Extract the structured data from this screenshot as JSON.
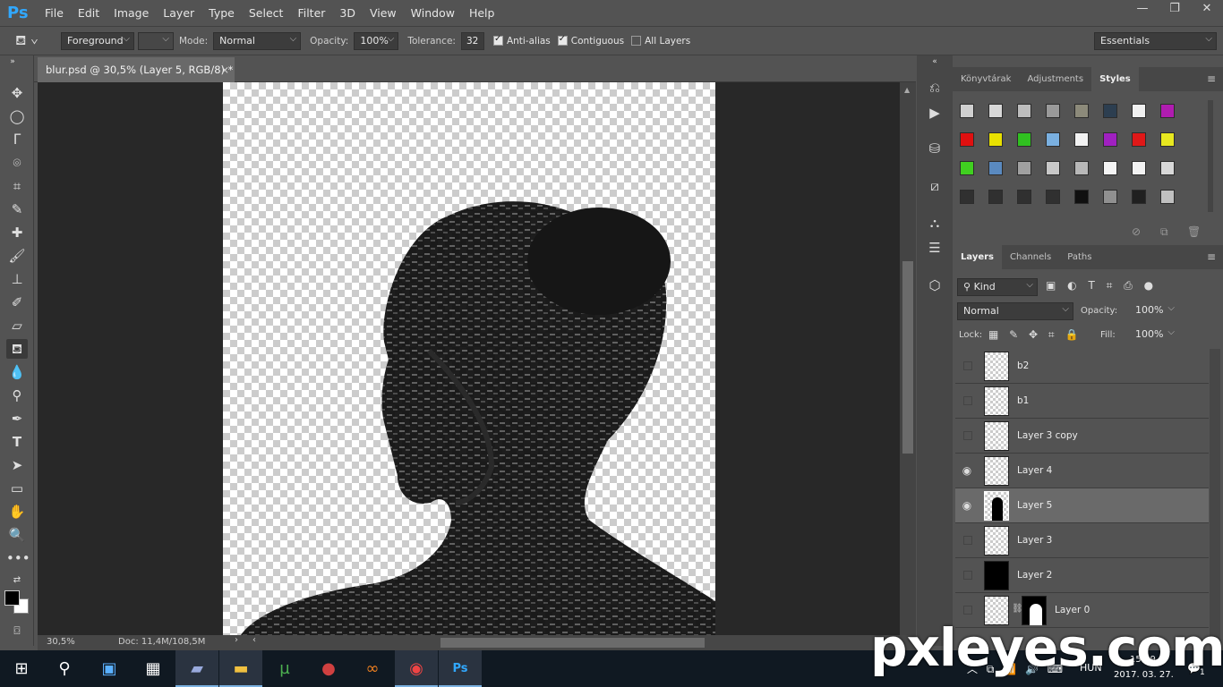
{
  "app": {
    "logo": "Ps",
    "menu": [
      "File",
      "Edit",
      "Image",
      "Layer",
      "Type",
      "Select",
      "Filter",
      "3D",
      "View",
      "Window",
      "Help"
    ]
  },
  "window_controls": {
    "minimize": "—",
    "restore": "❐",
    "close": "✕"
  },
  "options": {
    "fill_source": "Foreground",
    "mode_label": "Mode:",
    "mode_value": "Normal",
    "opacity_label": "Opacity:",
    "opacity_value": "100%",
    "tolerance_label": "Tolerance:",
    "tolerance_value": "32",
    "anti_alias": "Anti-alias",
    "contiguous": "Contiguous",
    "all_layers": "All Layers",
    "workspace": "Essentials"
  },
  "document": {
    "tab_title": "blur.psd @ 30,5% (Layer 5, RGB/8) *",
    "close": "×"
  },
  "status": {
    "zoom": "30,5%",
    "doc": "Doc: 11,4M/108,5M"
  },
  "styles_panel": {
    "tabs": [
      "Könyvtárak",
      "Adjustments",
      "Styles"
    ],
    "active_tab": "Styles",
    "swatch_colors": [
      [
        "#d0d0d0",
        "#d8d8d8",
        "#bdbdbd",
        "#9a9a9a",
        "#8c8a7a",
        "#2c3e50",
        "#f0f0f0",
        "#b01cb0"
      ],
      [
        "#e01010",
        "#e8e000",
        "#30c020",
        "#7ab0e0",
        "#f2f2f2",
        "#a020c0",
        "#e01818",
        "#e8e820"
      ],
      [
        "#40d020",
        "#5a8ac0",
        "#a0a0a0",
        "#c8c8c8",
        "#b8b8b8",
        "#f4f4f4",
        "#f2f2f2",
        "#d8d8d8"
      ],
      [
        "#303030",
        "#303030",
        "#303030",
        "#303030",
        "#101010",
        "#909090",
        "#202020",
        "#c0c0c0"
      ]
    ]
  },
  "layers_panel": {
    "tabs": [
      "Layers",
      "Channels",
      "Paths"
    ],
    "active_tab": "Layers",
    "filter_kind": "Kind",
    "blend_mode": "Normal",
    "opacity_label": "Opacity:",
    "opacity_value": "100%",
    "lock_label": "Lock:",
    "fill_label": "Fill:",
    "fill_value": "100%",
    "layers": [
      {
        "name": "b2",
        "visible": false,
        "selected": false
      },
      {
        "name": "b1",
        "visible": false,
        "selected": false
      },
      {
        "name": "Layer 3 copy",
        "visible": false,
        "selected": false
      },
      {
        "name": "Layer 4",
        "visible": true,
        "selected": false
      },
      {
        "name": "Layer 5",
        "visible": true,
        "selected": true
      },
      {
        "name": "Layer 3",
        "visible": false,
        "selected": false
      },
      {
        "name": "Layer 2",
        "visible": false,
        "selected": false
      },
      {
        "name": "Layer 0",
        "visible": false,
        "selected": false
      }
    ]
  },
  "taskbar": {
    "lang": "HUN",
    "time": "15:09",
    "date": "2017. 03. 27.",
    "notifications": "1"
  },
  "watermark": "pxleyes.com"
}
